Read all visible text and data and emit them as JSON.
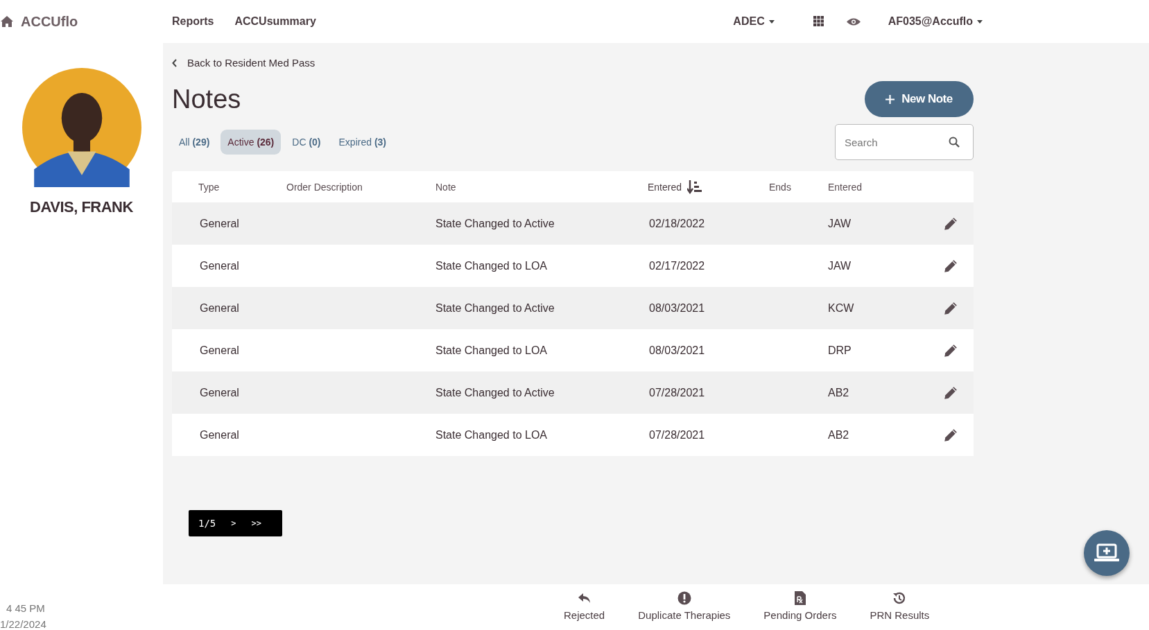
{
  "brand": "ACCUflo",
  "nav": [
    "Reports",
    "ACCUsummary"
  ],
  "facility": "ADEC",
  "user": "AF035@Accuflo",
  "resident": {
    "name": "DAVIS, FRANK"
  },
  "clock": {
    "time": "4 45 PM",
    "date": "1/22/2024"
  },
  "back_link": "Back to Resident Med Pass",
  "title": "Notes",
  "new_button": "New Note",
  "tabs": [
    {
      "label": "All",
      "count": "(29)",
      "selected": false
    },
    {
      "label": "Active",
      "count": "(26)",
      "selected": true
    },
    {
      "label": "DC",
      "count": "(0)",
      "selected": false
    },
    {
      "label": "Expired",
      "count": "(3)",
      "selected": false
    }
  ],
  "search": {
    "placeholder": "Search"
  },
  "table": {
    "columns": [
      {
        "label": "Type",
        "sorted": false
      },
      {
        "label": "Order Description",
        "sorted": false
      },
      {
        "label": "Note",
        "sorted": false
      },
      {
        "label": "Entered",
        "sorted": true
      },
      {
        "label": "Ends",
        "sorted": false
      },
      {
        "label": "Entered",
        "sorted": false
      }
    ],
    "rows": [
      {
        "type": "General",
        "note": "State Changed to Active",
        "entered": "02/18/2022",
        "by": "JAW"
      },
      {
        "type": "General",
        "note": "State Changed to LOA",
        "entered": "02/17/2022",
        "by": "JAW"
      },
      {
        "type": "General",
        "note": "State Changed to Active",
        "entered": "08/03/2021",
        "by": "KCW"
      },
      {
        "type": "General",
        "note": "State Changed to LOA",
        "entered": "08/03/2021",
        "by": "DRP"
      },
      {
        "type": "General",
        "note": "State Changed to Active",
        "entered": "07/28/2021",
        "by": "AB2"
      },
      {
        "type": "General",
        "note": "State Changed to LOA",
        "entered": "07/28/2021",
        "by": "AB2"
      }
    ]
  },
  "pagination": {
    "page": "1/5",
    "next": ">",
    "last": ">>"
  },
  "bottom_nav": [
    {
      "label": "Rejected",
      "kind": "reply"
    },
    {
      "label": "Duplicate Therapies",
      "kind": "alert"
    },
    {
      "label": "Pending Orders",
      "kind": "rx"
    },
    {
      "label": "PRN Results",
      "kind": "history"
    }
  ]
}
